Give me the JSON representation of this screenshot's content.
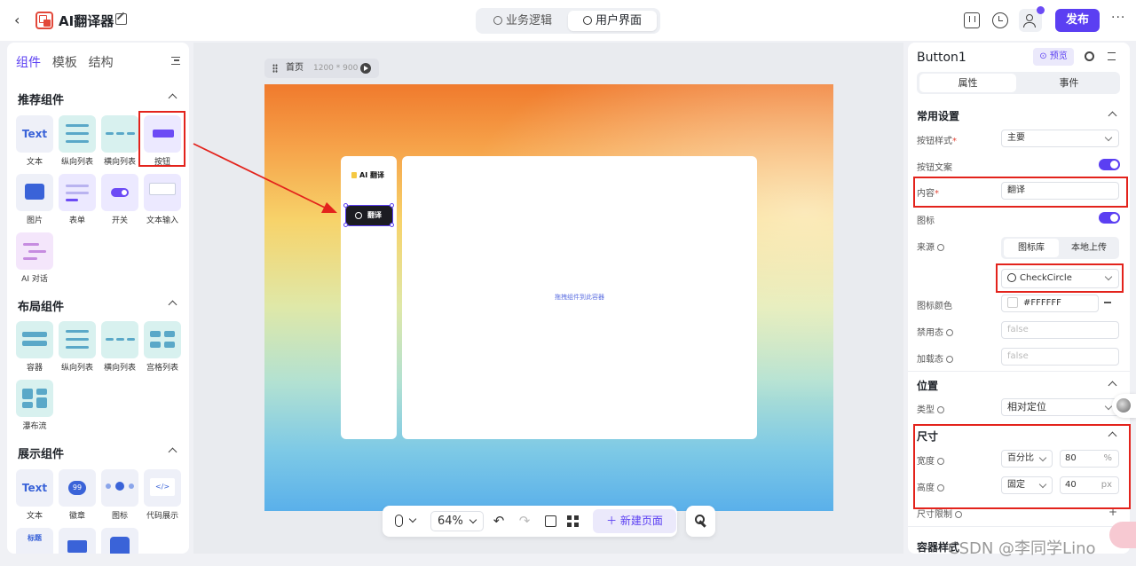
{
  "app": {
    "title": "AI翻译器",
    "mode_tabs": [
      {
        "label": "业务逻辑"
      },
      {
        "label": "用户界面"
      }
    ],
    "publish_label": "发布",
    "more_label": "···"
  },
  "left_panel": {
    "tabs": [
      {
        "label": "组件"
      },
      {
        "label": "模板"
      },
      {
        "label": "结构"
      }
    ],
    "sections": [
      {
        "title": "推荐组件",
        "items": [
          {
            "label": "文本",
            "icon": "text-component-icon",
            "tile_text": "Text"
          },
          {
            "label": "纵向列表",
            "icon": "vertical-list-icon"
          },
          {
            "label": "横向列表",
            "icon": "horizontal-list-icon"
          },
          {
            "label": "按钮",
            "icon": "button-component-icon",
            "tile_text": "Button"
          },
          {
            "label": "图片",
            "icon": "image-component-icon"
          },
          {
            "label": "表单",
            "icon": "form-component-icon"
          },
          {
            "label": "开关",
            "icon": "switch-component-icon"
          },
          {
            "label": "文本输入",
            "icon": "text-input-icon"
          },
          {
            "label": "AI 对话",
            "icon": "ai-chat-icon"
          }
        ]
      },
      {
        "title": "布局组件",
        "items": [
          {
            "label": "容器",
            "icon": "container-icon"
          },
          {
            "label": "纵向列表",
            "icon": "vertical-list-icon"
          },
          {
            "label": "横向列表",
            "icon": "horizontal-list-icon"
          },
          {
            "label": "宫格列表",
            "icon": "grid-list-icon"
          },
          {
            "label": "瀑布流",
            "icon": "waterfall-icon"
          }
        ]
      },
      {
        "title": "展示组件",
        "items": [
          {
            "label": "文本",
            "icon": "text-component-icon",
            "tile_text": "Text"
          },
          {
            "label": "徽章",
            "icon": "badge-icon",
            "tile_text": "99"
          },
          {
            "label": "图标",
            "icon": "icon-component-icon"
          },
          {
            "label": "代码展示",
            "icon": "code-display-icon",
            "tile_text": "</>"
          }
        ]
      }
    ],
    "partial_tile_text": "标题"
  },
  "canvas": {
    "page_name": "首页",
    "page_size": "1200 * 900",
    "brand": "AI 翻译",
    "button_label": "翻译",
    "drop_hint": "拖拽组件到此容器",
    "zoom": "64%",
    "new_page_label": "新建页面"
  },
  "right_panel": {
    "component_name": "Button1",
    "preview_label": "预览",
    "tabs": [
      {
        "label": "属性"
      },
      {
        "label": "事件"
      }
    ],
    "common": {
      "title": "常用设置",
      "button_style_label": "按钮样式",
      "button_style_value": "主要",
      "button_text_label": "按钮文案",
      "content_label": "内容",
      "content_value": "翻译",
      "icon_label": "图标",
      "source_label": "来源",
      "source_tabs": [
        {
          "label": "图标库"
        },
        {
          "label": "本地上传"
        }
      ],
      "icon_value": "CheckCircle",
      "icon_color_label": "图标颜色",
      "icon_color_value": "#FFFFFF",
      "disabled_label": "禁用态",
      "disabled_value": "false",
      "loading_label": "加载态",
      "loading_value": "false"
    },
    "position": {
      "title": "位置",
      "type_label": "类型",
      "type_value": "相对定位"
    },
    "size": {
      "title": "尺寸",
      "width_label": "宽度",
      "width_mode": "百分比",
      "width_value": "80",
      "width_unit": "%",
      "height_label": "高度",
      "height_mode": "固定",
      "height_value": "40",
      "height_unit": "px",
      "limit_label": "尺寸限制"
    },
    "next_section_partial": "容器样式"
  },
  "watermark": "CSDN @李同学Lino",
  "colors": {
    "accent": "#5b3ff2",
    "annotation_red": "#e3231c",
    "canvas_button": "#1c1c22"
  }
}
